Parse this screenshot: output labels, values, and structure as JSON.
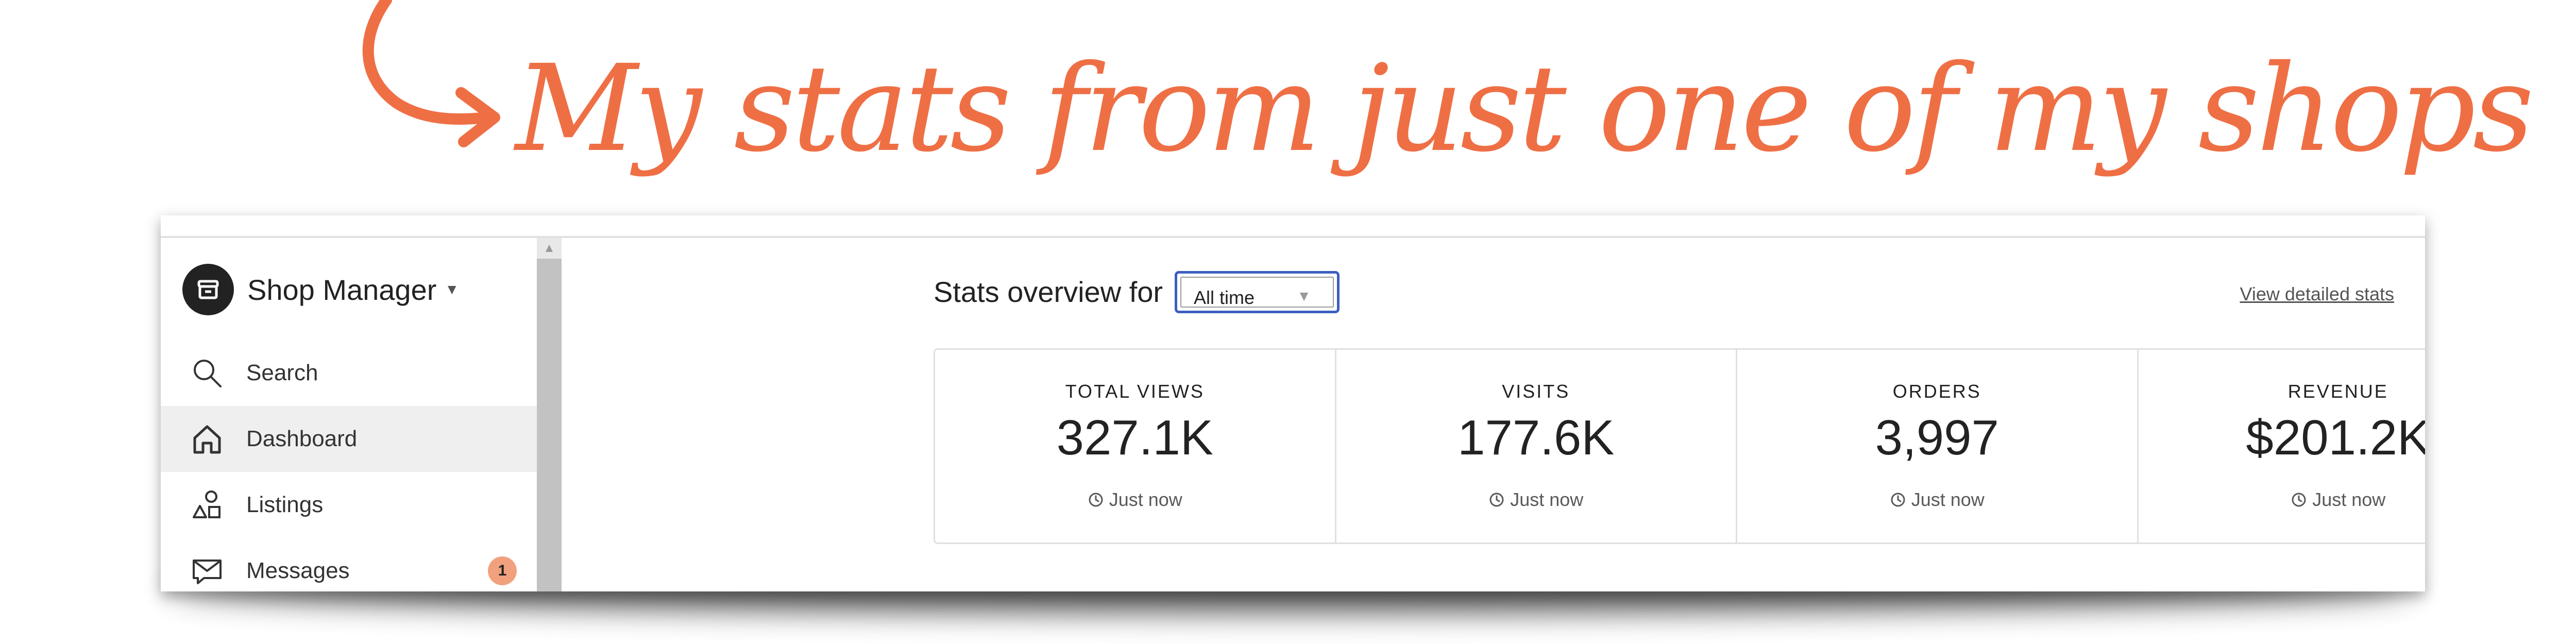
{
  "annotation": {
    "text": "My stats from just one of my shops",
    "color": "#ef6f45"
  },
  "sidebar": {
    "shop_title": "Shop Manager",
    "items": [
      {
        "label": "Search",
        "icon": "search-icon",
        "active": false
      },
      {
        "label": "Dashboard",
        "icon": "home-icon",
        "active": true
      },
      {
        "label": "Listings",
        "icon": "shapes-icon",
        "active": false
      },
      {
        "label": "Messages",
        "icon": "mail-icon",
        "active": false,
        "badge": "1"
      }
    ]
  },
  "main": {
    "overview_label": "Stats overview for",
    "range_select": {
      "value": "All time"
    },
    "detail_link": "View detailed stats",
    "stats": [
      {
        "label": "TOTAL VIEWS",
        "value": "327.1K",
        "updated": "Just now"
      },
      {
        "label": "VISITS",
        "value": "177.6K",
        "updated": "Just now"
      },
      {
        "label": "ORDERS",
        "value": "3,997",
        "updated": "Just now"
      },
      {
        "label": "REVENUE",
        "value": "$201.2K",
        "updated": "Just now"
      }
    ]
  },
  "colors": {
    "accent": "#ef6f45",
    "select_focus": "#3c5fbf",
    "badge": "#f1a17d"
  }
}
